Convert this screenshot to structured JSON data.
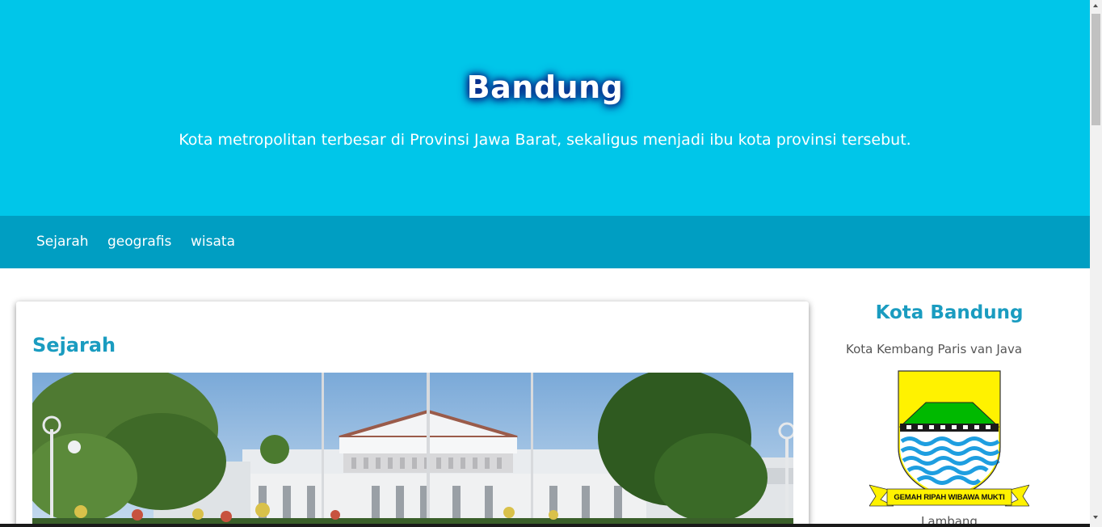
{
  "header": {
    "title": "Bandung",
    "tagline": "Kota metropolitan terbesar di Provinsi Jawa Barat, sekaligus menjadi ibu kota provinsi tersebut."
  },
  "nav": {
    "items": [
      "Sejarah",
      "geografis",
      "wisata"
    ]
  },
  "main": {
    "section_title": "Sejarah"
  },
  "sidebar": {
    "title": "Kota Bandung",
    "subtitle": "Kota Kembang Paris van Java",
    "emblem_text": "GEMAH RIPAH WIBAWA MUKTI",
    "caption": "Lambang"
  },
  "colors": {
    "header_bg": "#00c6e9",
    "nav_bg": "#009ec2",
    "accent": "#1a9cc0"
  }
}
